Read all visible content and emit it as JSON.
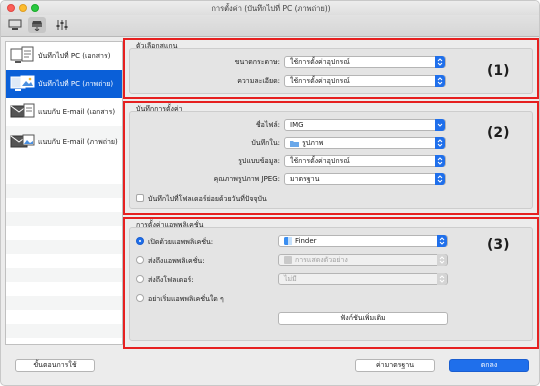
{
  "window": {
    "title": "การตั้งค่า (บันทึกไปที่ PC (ภาพถ่าย))"
  },
  "toolbar": {
    "icons": [
      "scan-from-computer-icon",
      "scan-from-panel-icon",
      "general-settings-icon"
    ]
  },
  "sidebar": {
    "items": [
      {
        "label": "บันทึกไปที่ PC (เอกสาร)",
        "icon": "save-document-icon"
      },
      {
        "label": "บันทึกไปที่ PC (ภาพถ่าย)",
        "icon": "save-photo-icon",
        "selected": true
      },
      {
        "label": "แนบกับ E-mail (เอกสาร)",
        "icon": "email-document-icon"
      },
      {
        "label": "แนบกับ E-mail (ภาพถ่าย)",
        "icon": "email-photo-icon"
      }
    ]
  },
  "scan_options": {
    "title": "ตัวเลือกสแกน",
    "number": "(1)",
    "paper_size_label": "ขนาดกระดาษ:",
    "paper_size_value": "ใช้การตั้งค่าอุปกรณ์",
    "resolution_label": "ความละเอียด:",
    "resolution_value": "ใช้การตั้งค่าอุปกรณ์"
  },
  "save_settings": {
    "title": "บันทึกการตั้งค่า",
    "number": "(2)",
    "file_name_label": "ชื่อไฟล์:",
    "file_name_value": "IMG",
    "save_in_label": "บันทึกใน:",
    "save_in_value": "รูปภาพ",
    "data_format_label": "รูปแบบข้อมูล:",
    "data_format_value": "ใช้การตั้งค่าอุปกรณ์",
    "jpeg_quality_label": "คุณภาพรูปภาพ JPEG:",
    "jpeg_quality_value": "มาตรฐาน",
    "subfolder_label": "บันทึกไปที่โฟลเดอร์ย่อยด้วยวันที่ปัจจุบัน"
  },
  "app_settings": {
    "title": "การตั้งค่าแอพพลิเคชั่น",
    "number": "(3)",
    "open_with_label": "เปิดด้วยแอพพลิเคชั่น:",
    "open_with_value": "Finder",
    "send_to_app_label": "ส่งถึงแอพพลิเคชั่น:",
    "send_to_app_value": "การแสดงตัวอย่าง",
    "send_to_folder_label": "ส่งถึงโฟลเดอร์:",
    "send_to_folder_value": "ไม่มี",
    "do_not_start_label": "อย่าเริ่มแอพพลิเคชั่นใด ๆ",
    "more_functions_label": "ฟังก์ชันเพิ่มเติม"
  },
  "footer": {
    "instructions_label": "ขั้นตอนการใช้",
    "defaults_label": "ค่ามาตรฐาน",
    "ok_label": "ตกลง"
  },
  "colors": {
    "highlight": "#e62020",
    "accent": "#1f6feb",
    "selection": "#0a5fd8"
  }
}
